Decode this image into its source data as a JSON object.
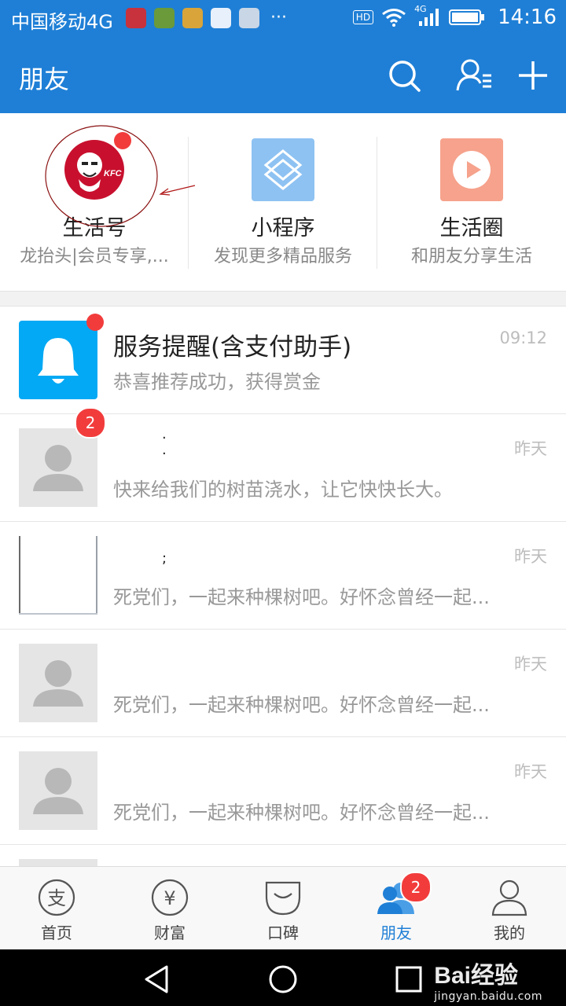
{
  "status_bar": {
    "carrier": "中国移动4G",
    "hd_label": "HD",
    "network_label": "4G",
    "time": "14:16",
    "more": "···"
  },
  "header": {
    "title": "朋友",
    "icons": [
      "search-icon",
      "contacts-icon",
      "add-icon"
    ]
  },
  "quick_entries": [
    {
      "title": "生活号",
      "subtitle": "龙抬头|会员专享,...",
      "icon": "kfc-logo",
      "has_dot": true
    },
    {
      "title": "小程序",
      "subtitle": "发现更多精品服务",
      "icon": "mini-program-icon"
    },
    {
      "title": "生活圈",
      "subtitle": "和朋友分享生活",
      "icon": "life-circle-icon"
    }
  ],
  "messages": [
    {
      "title": "服务提醒(含支付助手)",
      "preview": "恭喜推荐成功，获得赏金",
      "time": "09:12",
      "avatar": "bell-icon",
      "badge": "dot"
    },
    {
      "title": "",
      "preview": "快来给我们的树苗浇水，让它快快长大。",
      "time": "昨天",
      "avatar": "default-avatar",
      "badge": "2"
    },
    {
      "title": "",
      "preview": "死党们，一起来种棵树吧。好怀念曾经一起...",
      "time": "昨天",
      "avatar": "photo-avatar"
    },
    {
      "title": "",
      "preview": "死党们，一起来种棵树吧。好怀念曾经一起...",
      "time": "昨天",
      "avatar": "default-avatar"
    },
    {
      "title": "",
      "preview": "死党们，一起来种棵树吧。好怀念曾经一起...",
      "time": "昨天",
      "avatar": "default-avatar"
    }
  ],
  "tabs": [
    {
      "label": "首页",
      "icon": "alipay-home-icon"
    },
    {
      "label": "财富",
      "icon": "wealth-icon"
    },
    {
      "label": "口碑",
      "icon": "koubei-icon"
    },
    {
      "label": "朋友",
      "icon": "friends-icon",
      "active": true,
      "badge": "2"
    },
    {
      "label": "我的",
      "icon": "profile-icon"
    }
  ],
  "watermark": {
    "brand": "Bai经验",
    "url": "jingyan.baidu.com"
  },
  "colors": {
    "primary": "#1f7fd6",
    "badge": "#f23c3c",
    "bell_bg": "#03a9f4",
    "mini_program_bg": "#8ec2f2",
    "life_circle_bg": "#f6a28c"
  }
}
